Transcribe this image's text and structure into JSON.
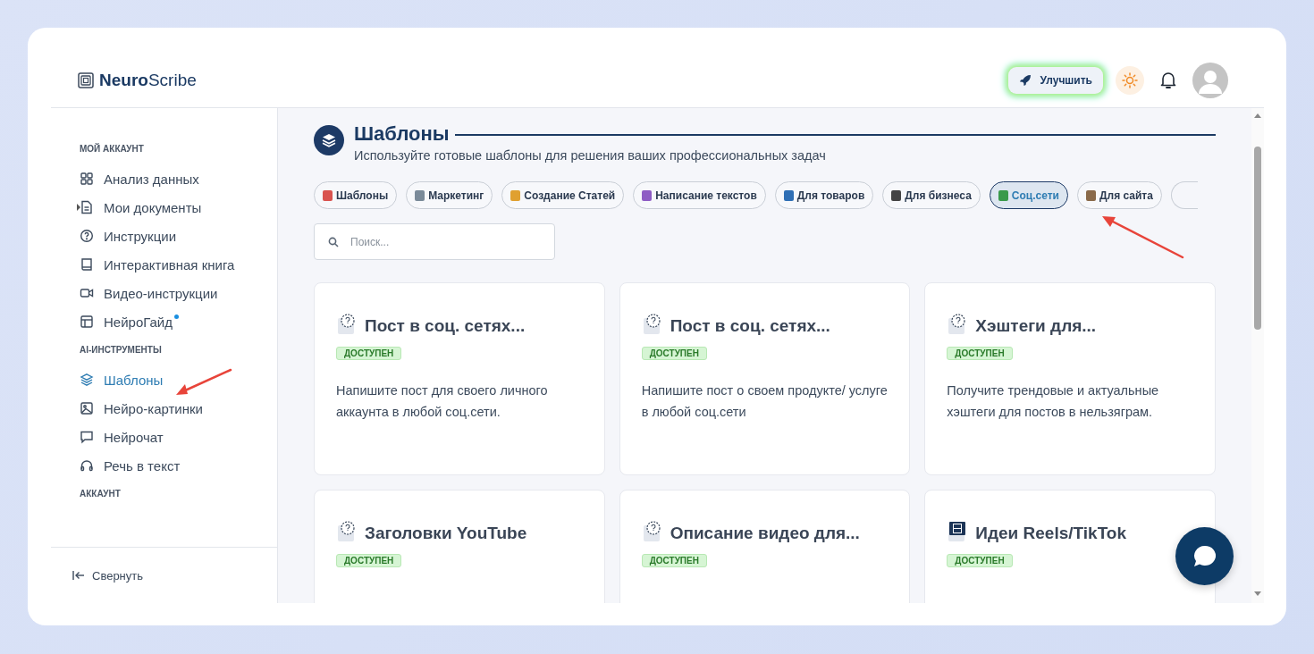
{
  "app": {
    "logo_bold": "Neuro",
    "logo_light": "Scribe"
  },
  "header": {
    "upgrade_button": "Улучшить"
  },
  "sidebar": {
    "sections": [
      {
        "title": "МОЙ АККАУНТ",
        "items": [
          {
            "label": "Анализ данных",
            "selected": false
          },
          {
            "label": "Мои документы",
            "selected": false,
            "expanded": false
          },
          {
            "label": "Инструкции",
            "selected": false
          },
          {
            "label": "Интерактивная книга",
            "selected": false
          },
          {
            "label": "Видео-инструкции",
            "selected": false
          },
          {
            "label": "НейроГайд",
            "selected": false,
            "new": true
          }
        ]
      },
      {
        "title": "AI-ИНСТРУМЕНТЫ",
        "items": [
          {
            "label": "Шаблоны",
            "selected": true
          },
          {
            "label": "Нейро-картинки",
            "selected": false
          },
          {
            "label": "Нейрочат",
            "selected": false
          },
          {
            "label": "Речь в текст",
            "selected": false
          }
        ]
      },
      {
        "title": "АККАУНТ"
      }
    ],
    "collapse_button": "Свернуть"
  },
  "page": {
    "title": "Шаблоны",
    "subtitle": "Используйте готовые шаблоны для решения ваших профессиональных задач"
  },
  "tabs": [
    {
      "label": "Шаблоны",
      "selected": false
    },
    {
      "label": "Маркетинг",
      "selected": false
    },
    {
      "label": "Создание Статей",
      "selected": false
    },
    {
      "label": "Написание текстов",
      "selected": false
    },
    {
      "label": "Для товаров",
      "selected": false
    },
    {
      "label": "Для бизнеса",
      "selected": false
    },
    {
      "label": "Соц.сети",
      "selected": true
    },
    {
      "label": "Для сайта",
      "selected": false
    }
  ],
  "search": {
    "placeholder": "Поиск..."
  },
  "cards": [
    {
      "title": "Пост в соц. сетях...",
      "badge": "ДОСТУПЕН",
      "description": "Напишите пост для своего личного аккаунта в любой соц.сети."
    },
    {
      "title": "Пост в соц. сетях...",
      "badge": "ДОСТУПЕН",
      "description": "Напишите пост о своем продукте/ услуге в любой соц.сети"
    },
    {
      "title": "Хэштеги для...",
      "badge": "ДОСТУПЕН",
      "description": "Получите трендовые и актуальные хэштеги для постов в нельзяграм."
    },
    {
      "title": "Заголовки YouTube",
      "badge": "ДОСТУПЕН"
    },
    {
      "title": "Описание видео для...",
      "badge": "ДОСТУПЕН"
    },
    {
      "title": "Идеи Reels/TikTok",
      "badge": "ДОСТУПЕН"
    }
  ]
}
